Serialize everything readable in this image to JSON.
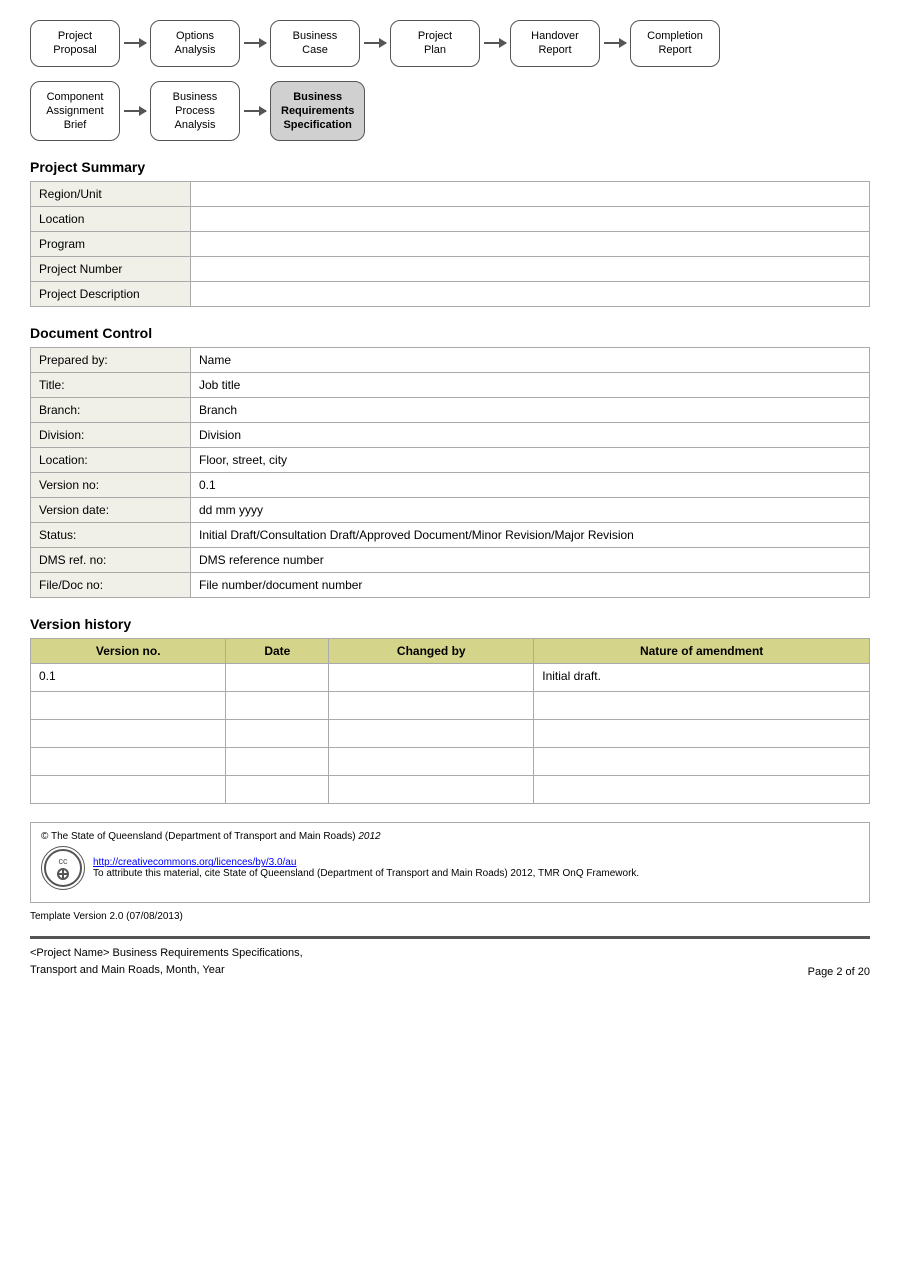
{
  "flow1": {
    "nodes": [
      {
        "label": "Project\nProposal",
        "highlighted": false
      },
      {
        "label": "Options\nAnalysis",
        "highlighted": false
      },
      {
        "label": "Business\nCase",
        "highlighted": false
      },
      {
        "label": "Project\nPlan",
        "highlighted": false
      },
      {
        "label": "Handover\nReport",
        "highlighted": false
      },
      {
        "label": "Completion\nReport",
        "highlighted": false
      }
    ]
  },
  "flow2": {
    "nodes": [
      {
        "label": "Component\nAssignment\nBrief",
        "highlighted": false
      },
      {
        "label": "Business\nProcess\nAnalysis",
        "highlighted": false
      },
      {
        "label": "Business\nRequirements\nSpecification",
        "highlighted": true
      }
    ]
  },
  "project_summary": {
    "heading": "Project Summary",
    "rows": [
      {
        "label": "Region/Unit",
        "value": ""
      },
      {
        "label": "Location",
        "value": ""
      },
      {
        "label": "Program",
        "value": ""
      },
      {
        "label": "Project Number",
        "value": ""
      },
      {
        "label": "Project Description",
        "value": ""
      }
    ]
  },
  "document_control": {
    "heading": "Document Control",
    "rows": [
      {
        "label": "Prepared by:",
        "value": "Name"
      },
      {
        "label": "Title:",
        "value": "Job title"
      },
      {
        "label": "Branch:",
        "value": "Branch"
      },
      {
        "label": "Division:",
        "value": "Division"
      },
      {
        "label": "Location:",
        "value": "Floor, street, city"
      },
      {
        "label": "Version no:",
        "value": "0.1"
      },
      {
        "label": "Version date:",
        "value": "dd mm yyyy"
      },
      {
        "label": "Status:",
        "value": "Initial Draft/Consultation Draft/Approved Document/Minor Revision/Major Revision"
      },
      {
        "label": "DMS ref. no:",
        "value": "DMS reference number"
      },
      {
        "label": "File/Doc no:",
        "value": "File number/document number"
      }
    ]
  },
  "version_history": {
    "heading": "Version history",
    "columns": [
      "Version no.",
      "Date",
      "Changed by",
      "Nature of amendment"
    ],
    "rows": [
      {
        "version": "0.1",
        "date": "",
        "changed_by": "",
        "nature": "Initial draft."
      },
      {
        "version": "",
        "date": "",
        "changed_by": "",
        "nature": ""
      },
      {
        "version": "",
        "date": "",
        "changed_by": "",
        "nature": ""
      },
      {
        "version": "",
        "date": "",
        "changed_by": "",
        "nature": ""
      },
      {
        "version": "",
        "date": "",
        "changed_by": "",
        "nature": ""
      }
    ]
  },
  "footer": {
    "copyright": "© The State of Queensland (Department of Transport and Main Roads) 2012",
    "cc_symbol": "©",
    "cc_link": "http://creativecommons.org/licences/by/3.0/au",
    "attribution": "To attribute this material, cite State of Queensland (Department of Transport and Main Roads) 2012, TMR OnQ Framework.",
    "template_version": "Template Version 2.0 (07/08/2013)"
  },
  "page_footer": {
    "left_line1": "<Project Name> Business Requirements Specifications,",
    "left_line2": "Transport and Main Roads, Month, Year",
    "right": "Page 2 of 20"
  }
}
